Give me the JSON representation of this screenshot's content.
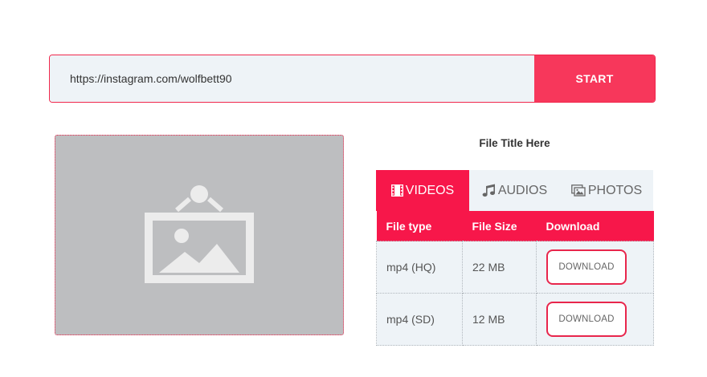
{
  "search": {
    "url_value": "https://instagram.com/wolfbett90",
    "start_label": "START"
  },
  "file": {
    "title": "File Title Here"
  },
  "tabs": [
    {
      "label": "VIDEOS",
      "icon": "film-icon"
    },
    {
      "label": "AUDIOS",
      "icon": "music-note-icon"
    },
    {
      "label": "PHOTOS",
      "icon": "photos-icon"
    }
  ],
  "table": {
    "headers": [
      "File type",
      "File Size",
      "Download"
    ],
    "rows": [
      {
        "type": "mp4 (HQ)",
        "size": "22 MB",
        "action": "DOWNLOAD"
      },
      {
        "type": "mp4 (SD)",
        "size": "12 MB",
        "action": "DOWNLOAD"
      }
    ]
  },
  "colors": {
    "accent": "#f7174a",
    "start_button": "#f7375b",
    "field_bg": "#eef3f7",
    "placeholder_bg": "#bdbec0"
  }
}
